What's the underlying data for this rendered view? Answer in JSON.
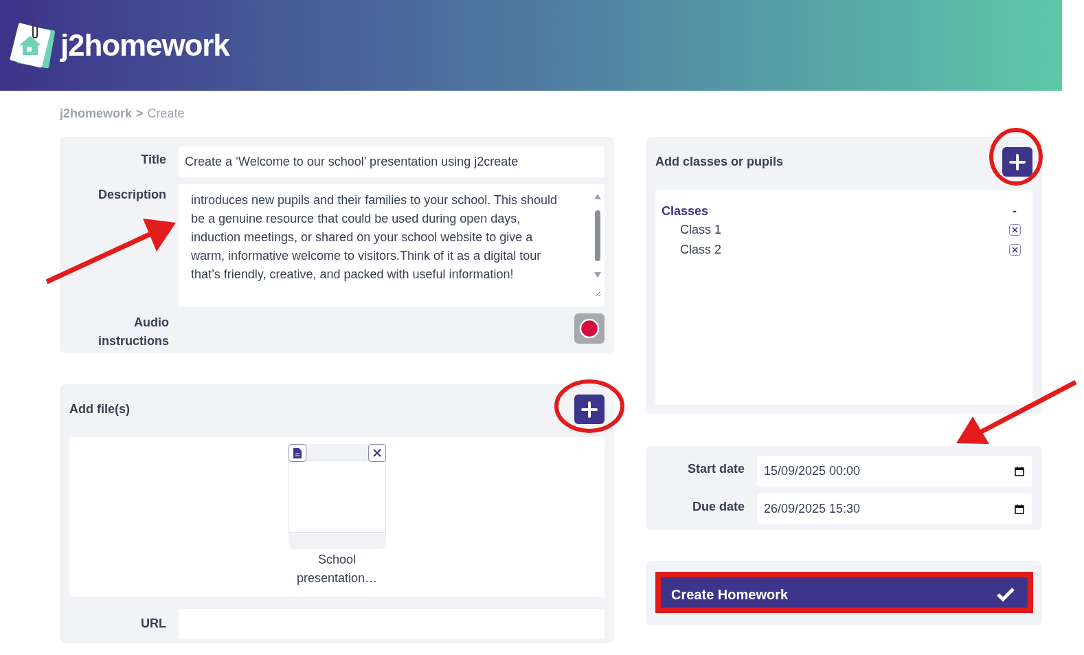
{
  "header": {
    "logo_text": "j2homework"
  },
  "breadcrumb": {
    "root": "j2homework",
    "separator": ">",
    "current": "Create"
  },
  "details": {
    "title_label": "Title",
    "title_value": "Create a ‘Welcome to our school’ presentation using j2create",
    "description_label": "Description",
    "description_value": "introduces new pupils and their families to your school. This should be a genuine resource that could be used during open days, induction meetings, or shared on your school website to give a warm, informative welcome to visitors.Think of it as a digital tour that’s friendly, creative, and packed with useful information!",
    "audio_label": "Audio instructions"
  },
  "files": {
    "heading": "Add file(s)",
    "items": [
      {
        "name": "School presentation…"
      }
    ],
    "url_label": "URL"
  },
  "assign": {
    "heading": "Add classes or pupils",
    "group": {
      "label": "Classes",
      "toggle": "-",
      "children": [
        {
          "label": "Class 1"
        },
        {
          "label": "Class 2"
        }
      ]
    }
  },
  "dates": [
    {
      "label": "Start date",
      "value": "15/09/2025 00:00"
    },
    {
      "label": "Due date",
      "value": "26/09/2025 15:30"
    }
  ],
  "submit": {
    "label": "Create Homework"
  }
}
